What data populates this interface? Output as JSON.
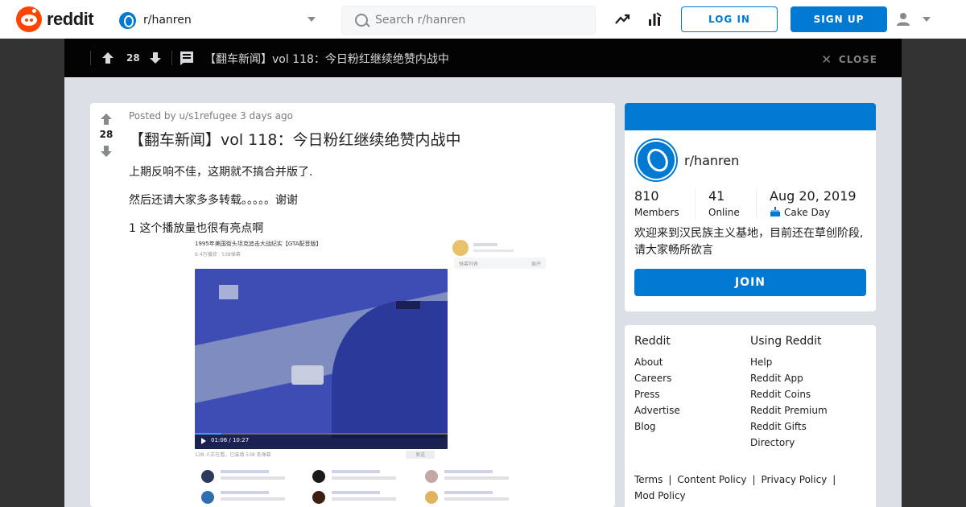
{
  "header": {
    "logo_text": "reddit",
    "community": "r/hanren",
    "search_placeholder": "Search r/hanren",
    "login_label": "LOG IN",
    "signup_label": "SIGN UP",
    "icons": [
      "trending-icon",
      "stats-icon",
      "user-icon",
      "chevron-down-icon"
    ]
  },
  "topbar": {
    "score": "28",
    "title": "【翻车新闻】vol 118：今日粉红继续绝赞内战中",
    "close_label": "CLOSE"
  },
  "post": {
    "score": "28",
    "meta": "Posted by u/s1refugee 3 days ago",
    "title": "【翻车新闻】vol 118：今日粉红继续绝赞内战中",
    "body": [
      "上期反响不佳，这期就不搞合并版了.",
      "然后还请大家多多转载。。。。。谢谢",
      "1 这个播放量也很有亮点啊"
    ],
    "image": {
      "video_title": "1995年美国街头坦克追击大战纪实【GTA配音版】",
      "video_meta": "6.4万播放 · 538弹幕",
      "time": "01:06 / 10:27",
      "progress": 0.105,
      "danmu_label": "弹幕列表",
      "danmu_more": "展开",
      "views_line": "138 人正在看，已装填 538 条弹幕",
      "send_label": "发送"
    }
  },
  "sidebar": {
    "name": "r/hanren",
    "members_value": "810",
    "members_label": "Members",
    "online_value": "41",
    "online_label": "Online",
    "cake_value": "Aug 20, 2019",
    "cake_label": "Cake Day",
    "description": "欢迎来到汉民族主义基地，目前还在草创阶段,请大家畅所欲言",
    "join_label": "JOIN",
    "banner_color": "#0079d3"
  },
  "footer": {
    "col1_title": "Reddit",
    "col1": [
      "About",
      "Careers",
      "Press",
      "Advertise",
      "Blog"
    ],
    "col2_title": "Using Reddit",
    "col2": [
      "Help",
      "Reddit App",
      "Reddit Coins",
      "Reddit Premium",
      "Reddit Gifts",
      "Directory"
    ],
    "links": [
      "Terms",
      "Content Policy",
      "Privacy Policy",
      "Mod Policy"
    ]
  }
}
